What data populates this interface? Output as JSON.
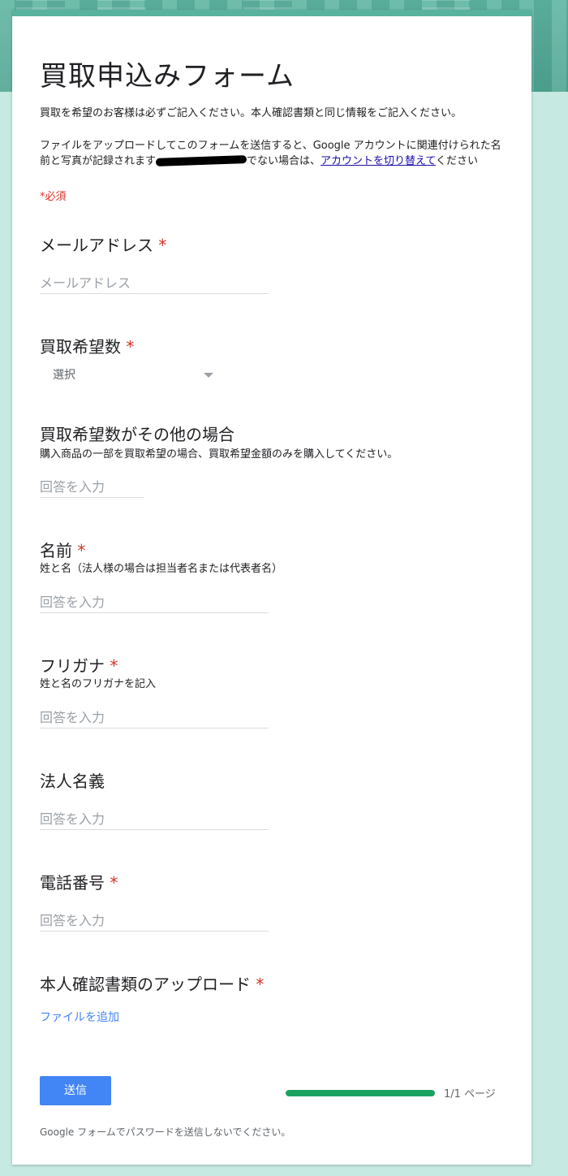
{
  "form": {
    "title": "買取申込みフォーム",
    "description_1": "買取を希望のお客様は必ずご記入ください。本人確認書類と同じ情報をご記入ください。",
    "description_2_a": "ファイルをアップロードしてこのフォームを送信すると、Google アカウントに関連付けられた名前と写真が記録されます",
    "description_2_b": "でない場合は、",
    "switch_account_link": "アカウントを切り替えて",
    "description_2_c": "ください",
    "required_note": "*必須"
  },
  "questions": [
    {
      "title": "メールアドレス",
      "required_mark": "*",
      "placeholder": "メールアドレス"
    },
    {
      "title": "買取希望数",
      "required_mark": "*",
      "select_value": "選択"
    },
    {
      "title": "買取希望数がその他の場合",
      "help": "購入商品の一部を買取希望の場合、買取希望金額のみを購入してください。",
      "placeholder": "回答を入力"
    },
    {
      "title": "名前",
      "required_mark": "*",
      "help": "姓と名（法人様の場合は担当者名または代表者名）",
      "placeholder": "回答を入力"
    },
    {
      "title": "フリガナ",
      "required_mark": "*",
      "help": "姓と名のフリガナを記入",
      "placeholder": "回答を入力"
    },
    {
      "title": "法人名義",
      "placeholder": "回答を入力"
    },
    {
      "title": "電話番号",
      "required_mark": "*",
      "placeholder": "回答を入力"
    },
    {
      "title": "本人確認書類のアップロード",
      "required_mark": "*",
      "add_file_label": "ファイルを追加"
    }
  ],
  "footer": {
    "submit_label": "送信",
    "progress_fraction": 1.0,
    "page_label": "1/1 ページ",
    "password_warning": "Google フォームでパスワードを送信しないでください。"
  },
  "colors": {
    "accent": "#4285f4",
    "theme": "#58b29d",
    "progress": "#1aa260",
    "required": "#d93025"
  }
}
